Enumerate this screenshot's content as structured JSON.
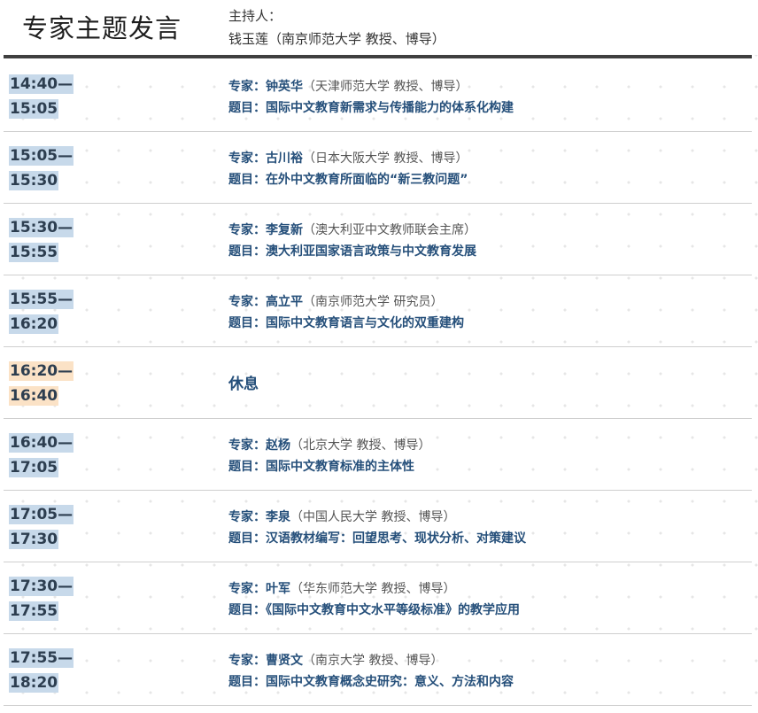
{
  "header": {
    "title": "专家主题发言",
    "host_label": "主持人：",
    "host_name": "钱玉莲（南京师范大学 教授、博导）"
  },
  "labels": {
    "expert": "专家：",
    "topic": "题目："
  },
  "sessions": [
    {
      "start": "14:40—",
      "end": "15:05",
      "expert": "钟英华",
      "affiliation": "（天津师范大学 教授、博导）",
      "topic": "国际中文教育新需求与传播能力的体系化构建"
    },
    {
      "start": "15:05—",
      "end": "15:30",
      "expert": "古川裕",
      "affiliation": "（日本大阪大学 教授、博导）",
      "topic": "在外中文教育所面临的“新三教问题”"
    },
    {
      "start": "15:30—",
      "end": "15:55",
      "expert": "李复新",
      "affiliation": "（澳大利亚中文教师联会主席）",
      "topic": "澳大利亚国家语言政策与中文教育发展"
    },
    {
      "start": "15:55—",
      "end": "16:20",
      "expert": "高立平",
      "affiliation": "（南京师范大学 研究员）",
      "topic": "国际中文教育语言与文化的双重建构"
    },
    {
      "start": "16:20—",
      "end": "16:40",
      "break_label": "休息"
    },
    {
      "start": "16:40—",
      "end": "17:05",
      "expert": "赵杨",
      "affiliation": "（北京大学 教授、博导）",
      "topic": "国际中文教育标准的主体性"
    },
    {
      "start": "17:05—",
      "end": "17:30",
      "expert": "李泉",
      "affiliation": "（中国人民大学 教授、博导）",
      "topic": "汉语教材编写：回望思考、现状分析、对策建议"
    },
    {
      "start": "17:30—",
      "end": "17:55",
      "expert": "叶军",
      "affiliation": "（华东师范大学 教授、博导）",
      "topic": "《国际中文教育中文水平等级标准》的教学应用"
    },
    {
      "start": "17:55—",
      "end": "18:20",
      "expert": "曹贤文",
      "affiliation": "（南京大学 教授、博导）",
      "topic": "国际中文教育概念史研究：意义、方法和内容"
    }
  ],
  "colors": {
    "time_highlight": "#c7d9ea",
    "break_highlight": "#fbe2c6",
    "accent_text": "#254f7a",
    "rule": "#3f3f3f"
  }
}
